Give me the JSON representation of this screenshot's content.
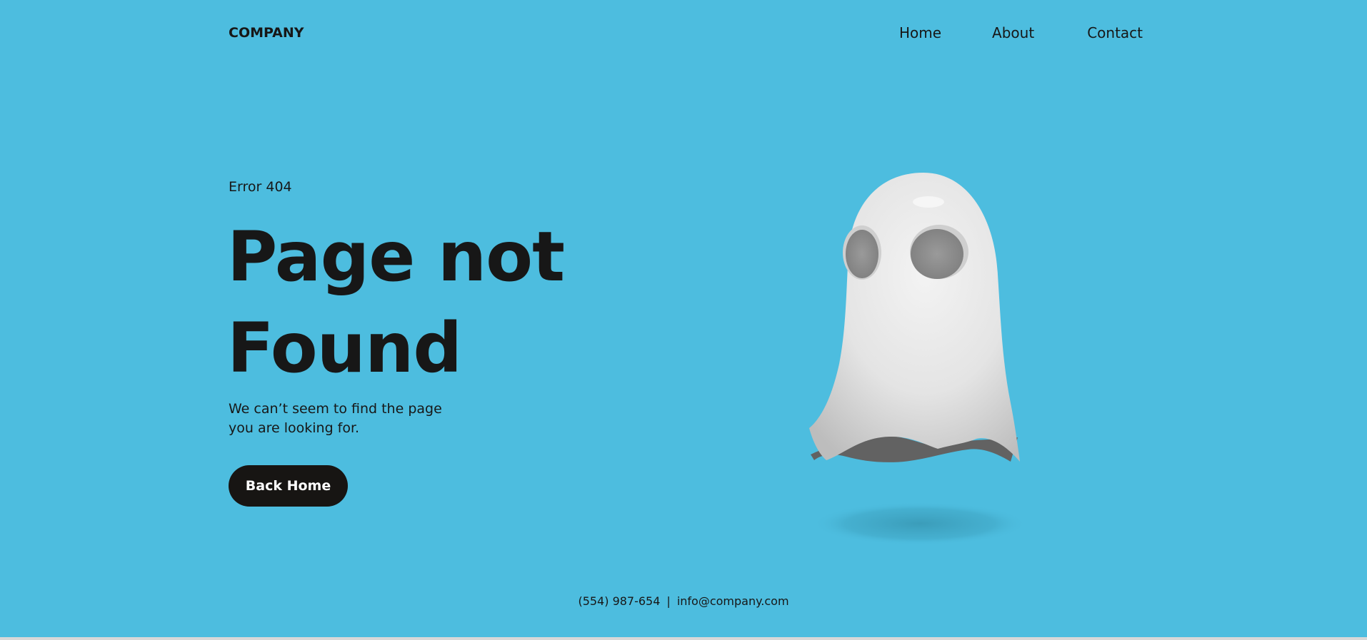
{
  "header": {
    "logo": "COMPANY",
    "nav": {
      "home": "Home",
      "about": "About",
      "contact": "Contact"
    }
  },
  "hero": {
    "eyebrow": "Error 404",
    "title_line1": "Page not",
    "title_line2": "Found",
    "description_line1": "We can’t seem to find the page",
    "description_line2": "you are looking for.",
    "button_label": "Back Home"
  },
  "illustration": {
    "icon": "ghost-icon"
  },
  "footer": {
    "phone": "(554) 987-654",
    "separator": "|",
    "email": "info@company.com"
  },
  "colors": {
    "background": "#4dbddf",
    "text": "#171717",
    "button": "#171513",
    "button_text": "#ffffff",
    "ghost_body": "#ececec",
    "ghost_shadow": "#3b97b3"
  }
}
